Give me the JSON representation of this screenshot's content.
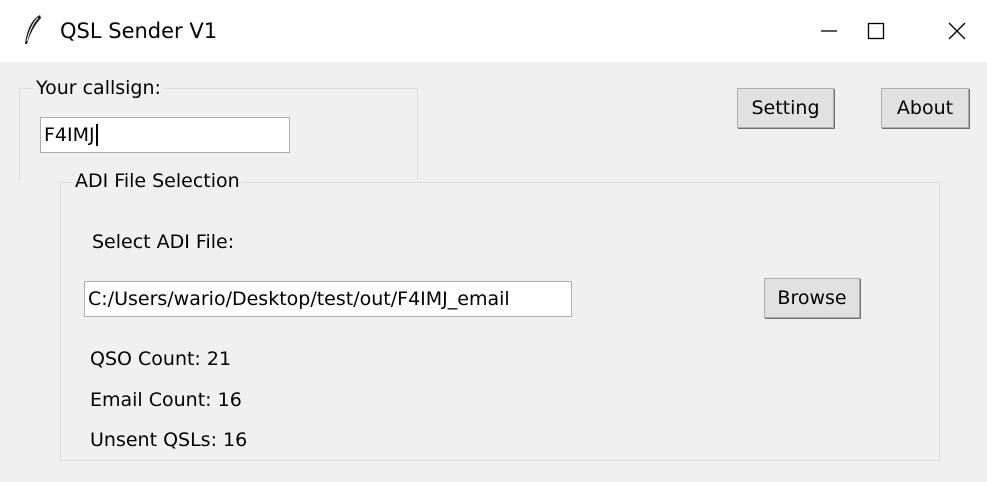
{
  "window": {
    "title": "QSL Sender V1",
    "controls": {
      "minimize": "minimize-icon",
      "maximize": "maximize-icon",
      "close": "close-icon"
    }
  },
  "callsign": {
    "label": "Your callsign:",
    "value": "F4IMJ"
  },
  "buttons": {
    "setting": "Setting",
    "about": "About",
    "browse": "Browse"
  },
  "adi": {
    "group_label": "ADI File Selection",
    "select_label": "Select ADI File:",
    "file_path": "C:/Users/wario/Desktop/test/out/F4IMJ_email",
    "qso_count": "QSO Count: 21",
    "email_count": "Email Count: 16",
    "unsent_qsls": "Unsent QSLs: 16"
  }
}
